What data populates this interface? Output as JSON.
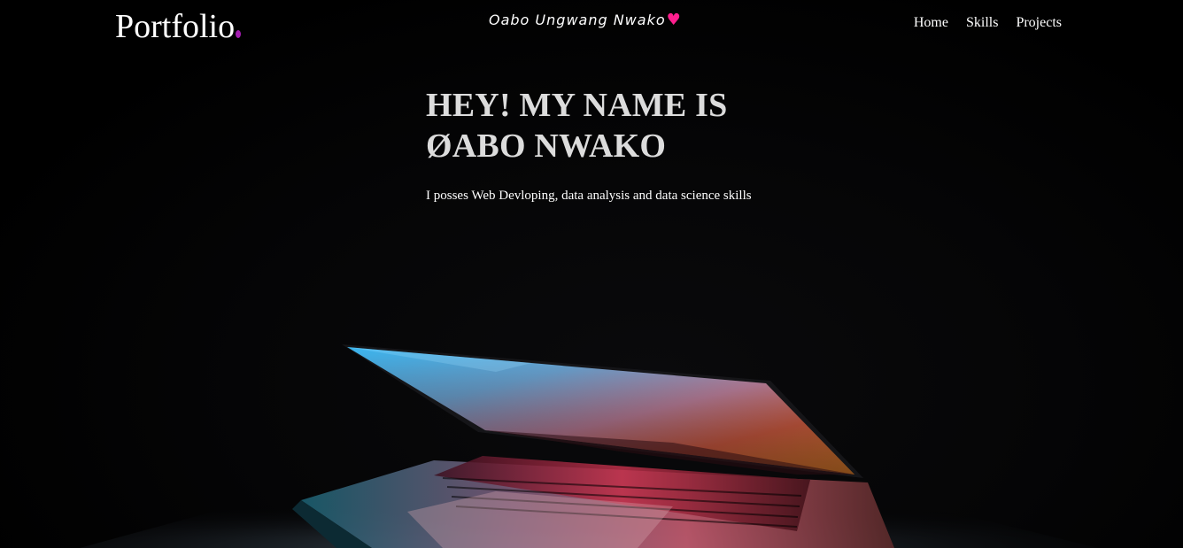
{
  "header": {
    "logo_text": "Portfolio",
    "tagline": "Oabo Ungwang Nwako",
    "tagline_heart": "♥",
    "nav": [
      {
        "label": "Home"
      },
      {
        "label": "Skills"
      },
      {
        "label": "Projects"
      }
    ]
  },
  "hero": {
    "title_line1": "HEY! MY NAME IS",
    "title_line2": "ØABO NWAKO",
    "subtitle": "I posses Web Devloping, data analysis and data science skills",
    "image_subject": "glowing laptop half-open in the dark"
  },
  "colors": {
    "background": "#000000",
    "accent_heart": "#ff1f8e",
    "logo_dot": "#a21caf",
    "title": "#dcdcdc"
  }
}
